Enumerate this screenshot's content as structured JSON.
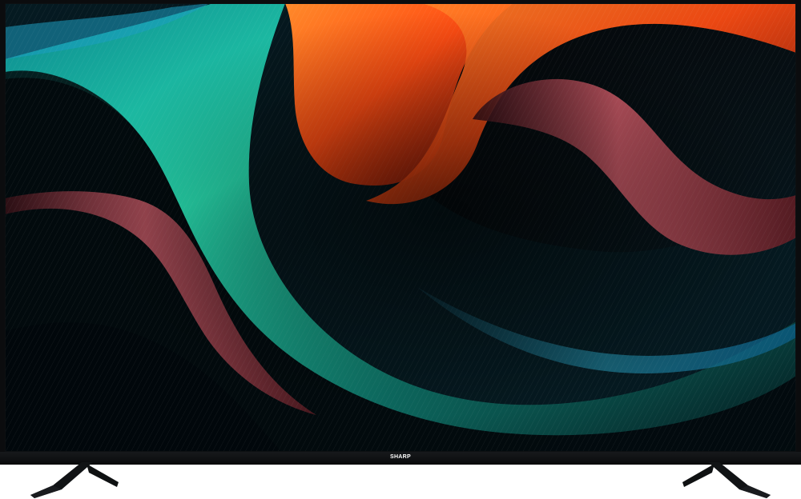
{
  "tv": {
    "brand_label": "SHARP",
    "screen_palette": {
      "teal": "#18d7b2",
      "orange": "#ff5a1f",
      "rose": "#d95b6e",
      "blue": "#1a6e8b",
      "black": "#04080c"
    }
  }
}
